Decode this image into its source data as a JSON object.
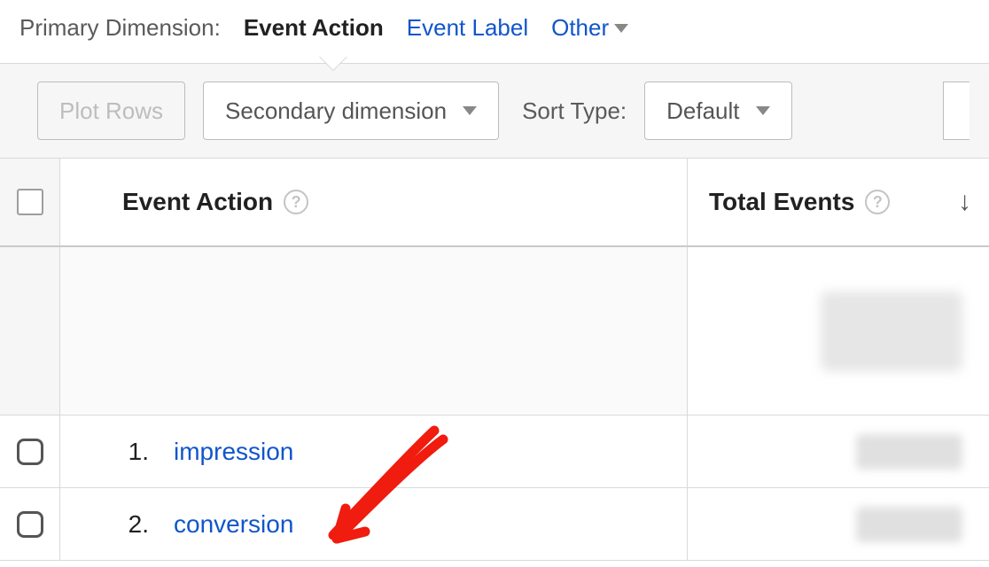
{
  "dimension": {
    "label": "Primary Dimension:",
    "active": "Event Action",
    "tabs": [
      "Event Label",
      "Other"
    ]
  },
  "toolbar": {
    "plot_rows": "Plot Rows",
    "secondary_dimension": "Secondary dimension",
    "sort_type_label": "Sort Type:",
    "sort_default": "Default"
  },
  "headers": {
    "event_action": "Event Action",
    "total_events": "Total Events"
  },
  "rows": [
    {
      "index": "1.",
      "name": "impression"
    },
    {
      "index": "2.",
      "name": "conversion"
    }
  ]
}
